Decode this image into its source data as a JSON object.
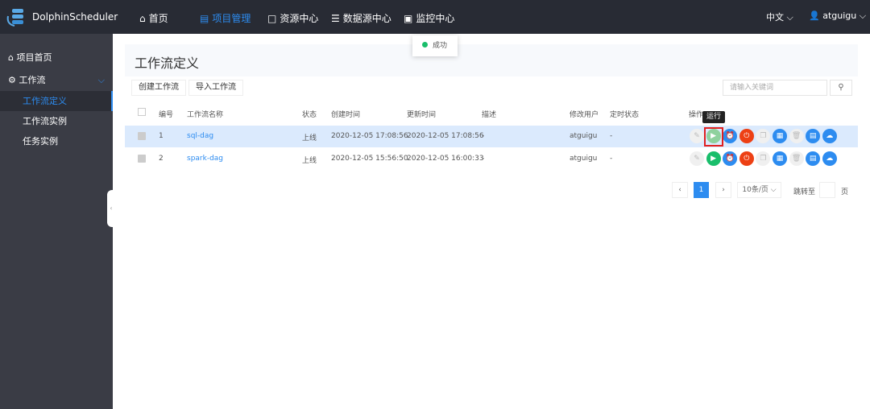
{
  "topbar": {
    "brand": "DolphinScheduler",
    "nav": [
      "首页",
      "项目管理",
      "资源中心",
      "数据源中心",
      "监控中心"
    ],
    "active_nav": 1,
    "language": "中文",
    "user": "atguigu"
  },
  "toast": {
    "text": "成功",
    "color": "#19be6b"
  },
  "sidebar": {
    "items": [
      "项目首页",
      "工作流",
      "工作流定义",
      "工作流实例",
      "任务实例"
    ],
    "active": 2
  },
  "page": {
    "title": "工作流定义",
    "create_button": "创建工作流",
    "import_button": "导入工作流",
    "search_placeholder": "请输入关键词"
  },
  "table": {
    "headers": [
      "编号",
      "工作流名称",
      "状态",
      "创建时间",
      "更新时间",
      "描述",
      "修改用户",
      "定时状态",
      "操作"
    ],
    "rows": [
      {
        "id": "1",
        "name": "sql-dag",
        "status": "上线",
        "created": "2020-12-05 17:08:56",
        "updated": "2020-12-05 17:08:56",
        "desc": "-",
        "user": "atguigu",
        "timing": "-"
      },
      {
        "id": "2",
        "name": "spark-dag",
        "status": "上线",
        "created": "2020-12-05 15:56:50",
        "updated": "2020-12-05 16:00:33",
        "desc": "-",
        "user": "atguigu",
        "timing": "-"
      }
    ],
    "actions": [
      {
        "name": "edit-icon",
        "color": "#eeeeee"
      },
      {
        "name": "run-icon",
        "color": "#19be6b"
      },
      {
        "name": "timer-icon",
        "color": "#2d8cf0"
      },
      {
        "name": "offline-icon",
        "color": "#ed4014"
      },
      {
        "name": "copy-icon",
        "color": "#eeeeee"
      },
      {
        "name": "tree-view-icon",
        "color": "#2d8cf0"
      },
      {
        "name": "delete-icon",
        "color": "#eeeeee"
      },
      {
        "name": "export-icon",
        "color": "#2d8cf0"
      },
      {
        "name": "upload-icon",
        "color": "#2d8cf0"
      }
    ],
    "tooltip": "运行"
  },
  "pagination": {
    "current": "1",
    "page_size": "10条/页",
    "jump_label": "跳转至",
    "page_suffix": "页"
  }
}
